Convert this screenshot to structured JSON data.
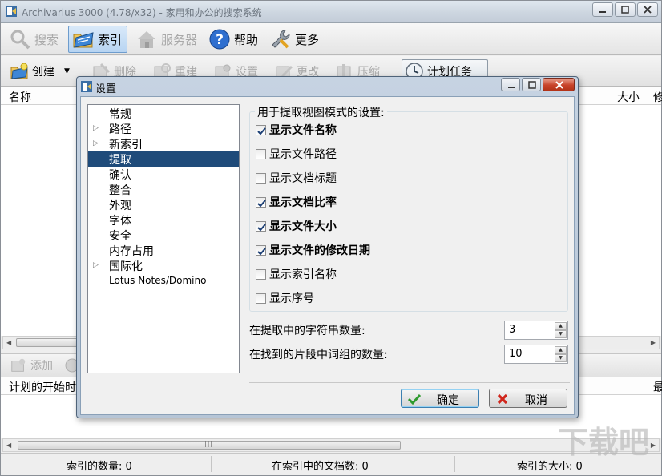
{
  "main_window": {
    "title": "Archivarius 3000 (4.78/x32) - 家用和办公的搜索系统",
    "toolbar_main": [
      {
        "label": "搜索",
        "icon": "magnifier-icon",
        "state": "disabled"
      },
      {
        "label": "索引",
        "icon": "folder-index-icon",
        "state": "active"
      },
      {
        "label": "服务器",
        "icon": "server-house-icon",
        "state": "disabled"
      },
      {
        "label": "帮助",
        "icon": "help-icon",
        "state": "normal"
      },
      {
        "label": "更多",
        "icon": "wrench-icon",
        "state": "normal"
      }
    ],
    "toolbar_index": [
      {
        "label": "创建",
        "icon": "create-index-icon",
        "state": "normal"
      },
      {
        "label": "删除",
        "icon": "delete-icon",
        "state": "disabled"
      },
      {
        "label": "重建",
        "icon": "rebuild-icon",
        "state": "disabled"
      },
      {
        "label": "设置",
        "icon": "settings-icon",
        "state": "disabled"
      },
      {
        "label": "更改",
        "icon": "change-icon",
        "state": "disabled"
      },
      {
        "label": "压缩",
        "icon": "compress-icon",
        "state": "disabled"
      },
      {
        "label": "计划任务",
        "icon": "clock-icon",
        "state": "active"
      }
    ],
    "index_list_columns": [
      "名称",
      "大小",
      "修"
    ],
    "tasks_toolbar": [
      {
        "label": "添加",
        "icon": "add-icon",
        "state": "disabled"
      }
    ],
    "tasks_list_columns": [
      "计划的开始时",
      "最"
    ],
    "statusbar": {
      "index_count": "索引的数量: 0",
      "doc_count": "在索引中的文档数: 0",
      "index_size": "索引的大小: 0"
    },
    "watermark_text": "下载吧"
  },
  "dialog": {
    "title": "设置",
    "tree": [
      {
        "label": "常规",
        "expandable": false,
        "selected": false
      },
      {
        "label": "路径",
        "expandable": true,
        "selected": false
      },
      {
        "label": "新索引",
        "expandable": true,
        "selected": false
      },
      {
        "label": "提取",
        "expandable": false,
        "selected": true
      },
      {
        "label": "确认",
        "expandable": false,
        "selected": false
      },
      {
        "label": "整合",
        "expandable": false,
        "selected": false
      },
      {
        "label": "外观",
        "expandable": false,
        "selected": false
      },
      {
        "label": "字体",
        "expandable": false,
        "selected": false
      },
      {
        "label": "安全",
        "expandable": false,
        "selected": false
      },
      {
        "label": "内存占用",
        "expandable": false,
        "selected": false
      },
      {
        "label": "国际化",
        "expandable": true,
        "selected": false
      },
      {
        "label": "Lotus Notes/Domino",
        "expandable": false,
        "selected": false
      }
    ],
    "group_title": "用于提取视图模式的设置:",
    "options": [
      {
        "label": "显示文件名称",
        "checked": true
      },
      {
        "label": "显示文件路径",
        "checked": false
      },
      {
        "label": "显示文档标题",
        "checked": false
      },
      {
        "label": "显示文档比率",
        "checked": true
      },
      {
        "label": "显示文件大小",
        "checked": true
      },
      {
        "label": "显示文件的修改日期",
        "checked": true
      },
      {
        "label": "显示索引名称",
        "checked": false
      },
      {
        "label": "显示序号",
        "checked": false
      }
    ],
    "string_count_label": "在提取中的字符串数量:",
    "string_count_value": "3",
    "phrase_count_label": "在找到的片段中词组的数量:",
    "phrase_count_value": "10",
    "ok_label": "确定",
    "cancel_label": "取消"
  }
}
